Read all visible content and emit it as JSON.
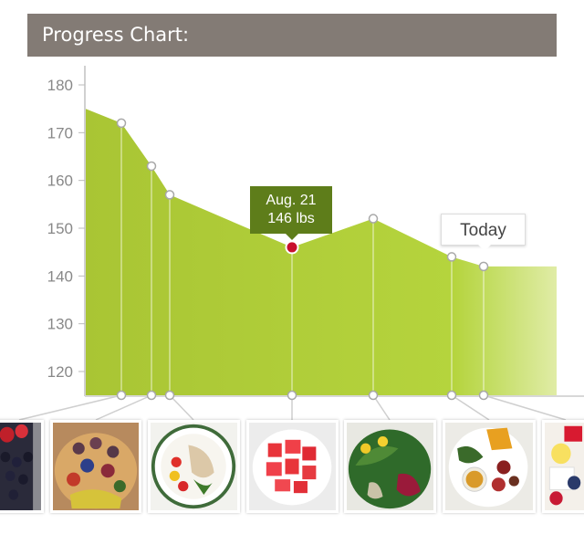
{
  "header": {
    "title": "Progress Chart:"
  },
  "tooltip": {
    "date": "Aug. 21",
    "weight": "146 lbs"
  },
  "today_label": "Today",
  "colors": {
    "header_bg": "#837b75",
    "area_fill": "#acc93a",
    "tooltip_bg": "#5e7d1a",
    "highlight_point": "#c8102e"
  },
  "chart_data": {
    "type": "area",
    "title": "Progress Chart:",
    "xlabel": "",
    "ylabel": "",
    "ylim": [
      113,
      185
    ],
    "yticks": [
      120,
      130,
      140,
      150,
      160,
      170,
      180
    ],
    "grid": false,
    "legend": "none",
    "start_value": 175,
    "end_value": 142,
    "points": [
      {
        "y": 172,
        "label": ""
      },
      {
        "y": 163,
        "label": ""
      },
      {
        "y": 157,
        "label": ""
      },
      {
        "y": 146,
        "label": "Aug. 21",
        "highlight": true
      },
      {
        "y": 152,
        "label": ""
      },
      {
        "y": 144,
        "label": ""
      },
      {
        "y": 142,
        "label": "Today"
      }
    ]
  },
  "photos": [
    {
      "name": "photo-blackberries",
      "icon": "berries-photo"
    },
    {
      "name": "photo-fruit-platter",
      "icon": "fruit-platter-photo"
    },
    {
      "name": "photo-chicken-salad",
      "icon": "chicken-salad-photo"
    },
    {
      "name": "photo-watermelon",
      "icon": "watermelon-photo"
    },
    {
      "name": "photo-green-salad",
      "icon": "green-salad-photo"
    },
    {
      "name": "photo-dinner-plate",
      "icon": "dinner-plate-photo"
    },
    {
      "name": "photo-dessert",
      "icon": "dessert-photo"
    }
  ]
}
